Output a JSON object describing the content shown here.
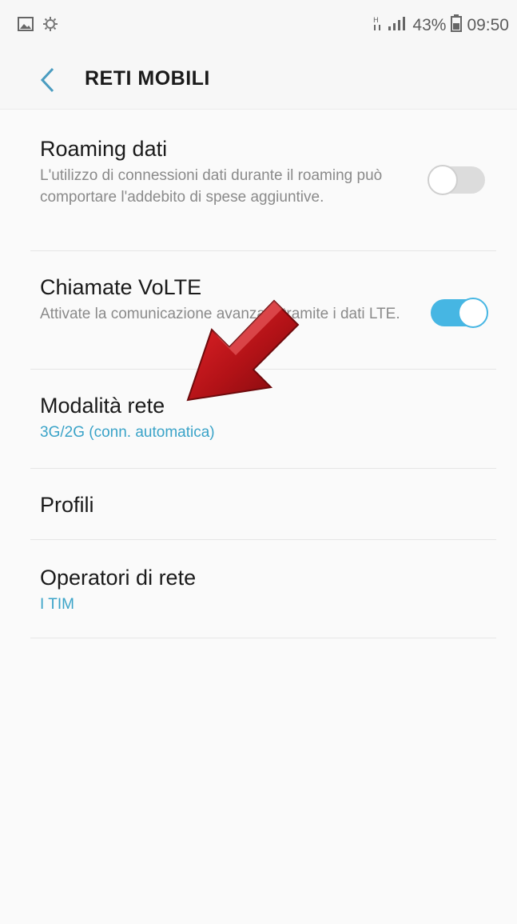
{
  "status_bar": {
    "battery_percent": "43%",
    "time": "09:50",
    "icons": [
      "image-icon",
      "sync-icon",
      "network-type-icon",
      "signal-icon",
      "battery-icon"
    ]
  },
  "header": {
    "title": "RETI MOBILI",
    "back_icon": "chevron-left-icon"
  },
  "settings": {
    "roaming": {
      "title": "Roaming dati",
      "subtitle": "L'utilizzo di connessioni dati durante il roaming può comportare l'addebito di spese aggiuntive.",
      "enabled": false
    },
    "volte": {
      "title": "Chiamate VoLTE",
      "subtitle": "Attivate la comunicazione avanzata tramite i dati LTE.",
      "enabled": true
    },
    "network_mode": {
      "title": "Modalità rete",
      "value": "3G/2G (conn. automatica)"
    },
    "profiles": {
      "title": "Profili"
    },
    "operators": {
      "title": "Operatori di rete",
      "value": "I TIM"
    }
  },
  "colors": {
    "accent": "#3aa3c8",
    "toggle_on": "#46b6e3",
    "arrow": "#c4161c"
  }
}
